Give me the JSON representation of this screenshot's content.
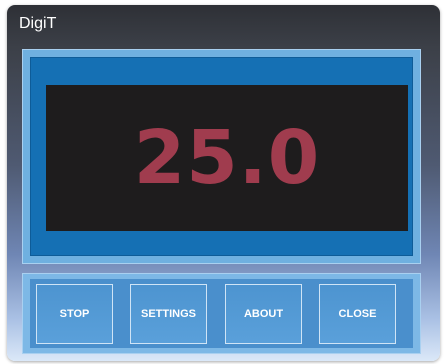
{
  "window": {
    "title": "DigiT"
  },
  "display": {
    "value": "25.0",
    "value_color": "#a03c4e",
    "background_color": "#1e1c1d"
  },
  "buttons": {
    "stop_label": "STOP",
    "settings_label": "SETTINGS",
    "about_label": "ABOUT",
    "close_label": "CLOSE"
  }
}
